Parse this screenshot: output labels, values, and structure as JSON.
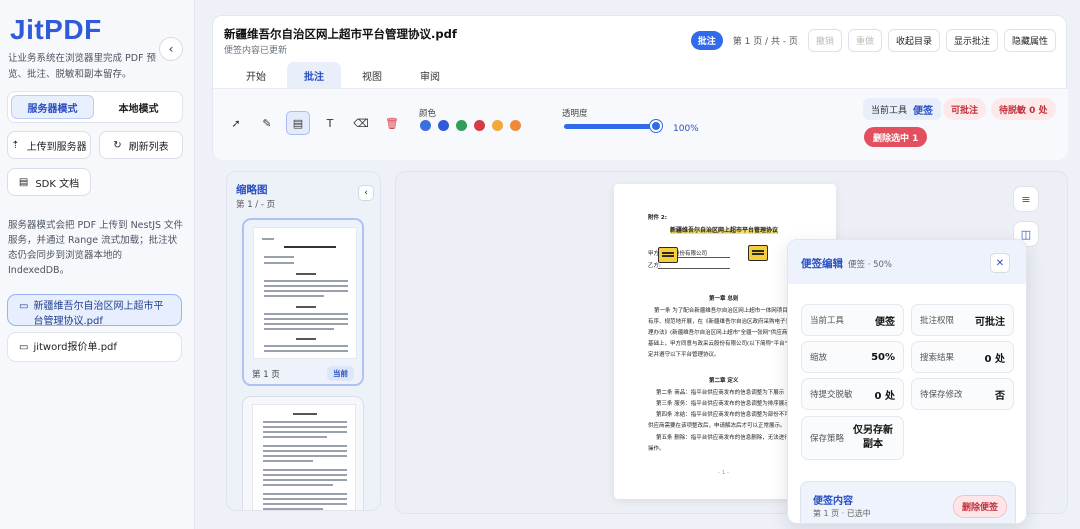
{
  "sidebar": {
    "logo": "JitPDF",
    "intro": "让业务系统在浏览器里完成 PDF 预览、批注、脱敏和副本留存。",
    "modes": [
      "服务器模式",
      "本地模式"
    ],
    "buttons": {
      "upload": "上传到服务器",
      "refresh": "刷新列表",
      "sdk": "SDK 文档"
    },
    "note": "服务器模式会把 PDF 上传到 NestJS 文件服务，并通过 Range 流式加载；批注状态仍会同步到浏览器本地的 IndexedDB。",
    "files": [
      "新疆维吾尔自治区网上超市平台管理协议.pdf",
      "jitword报价单.pdf"
    ]
  },
  "header": {
    "title": "新疆维吾尔自治区网上超市平台管理协议.pdf",
    "subtitle": "便签内容已更新",
    "badge": "批注",
    "page_info": "第 1 页 / 共 - 页",
    "undo": "撤销",
    "redo": "重做",
    "collapse_toc": "收起目录",
    "show_annotations": "显示批注",
    "hide_properties": "隐藏属性"
  },
  "tabs": [
    "开始",
    "批注",
    "视图",
    "审阅"
  ],
  "toolbar": {
    "color_label": "颜色",
    "colors": [
      "#3b6fe0",
      "#2f5bd8",
      "#2f9e58",
      "#d63a48",
      "#f0a93a",
      "#f08a3a"
    ],
    "opacity_label": "透明度",
    "opacity_value": "100%",
    "opacity_fraction": 1.0,
    "current_tool_label": "当前工具",
    "current_tool": "便签",
    "can_annotate": "可批注",
    "pending_redaction": "待脱敏 0 处",
    "delete_selected": "删除选中 1"
  },
  "thumbnails": {
    "title": "缩略图",
    "sub": "第 1 / - 页",
    "page1_label": "第 1 页",
    "current_tag": "当前"
  },
  "document": {
    "attachment": "附件 2:",
    "title": "新疆维吾尔自治区网上超市平台管理协议",
    "party_a": "甲方:",
    "party_a_name": "股份有限公司",
    "party_b": "乙方:",
    "chapter1": "第一章 总则",
    "para1": "第一条 为了配合新疆维吾尔自治区网上超市一体网项目",
    "para1b": "有序、规范地开展，在《新疆维吾尔自治区政府采购电子卖场",
    "para1c": "理办法》(新疆维吾尔自治区网上超市\"全疆一张网\"供应商承诺",
    "para1d": "基础上，甲方同意与政采云股份有限公司(以下简称\"平台\"",
    "para1e": "定并遵守以下平台管理协议。",
    "chapter2": "第二章 定义",
    "def2": "第二条 商品：指平台供应商发布的信息调整为下展示",
    "def3": "第三条 服务：指平台供应商发布的信息调整为排序展示",
    "def4": "第四条 冻结：指平台供应商发布的信息调整为部份不可",
    "def4b": "供应商需要在该项整改后，申请解冻后才可以正常展示。",
    "def5": "第五条 删除：指平台供应商发布的信息删除，无法进行",
    "def5b": "操作。",
    "page_no": "- 1 -"
  },
  "edit_panel": {
    "title": "便签编辑",
    "sub": "便签 · 50%",
    "cells": [
      {
        "label": "当前工具",
        "value": "便签"
      },
      {
        "label": "批注权限",
        "value": "可批注"
      },
      {
        "label": "缩放",
        "value": "50%"
      },
      {
        "label": "搜索结果",
        "value": "0 处"
      },
      {
        "label": "待提交脱敏",
        "value": "0 处"
      },
      {
        "label": "待保存修改",
        "value": "否"
      },
      {
        "label": "保存策略",
        "value": "仅另存新副本"
      }
    ],
    "section_title": "便签内容",
    "section_sub": "第 1 页 · 已选中",
    "delete_note": "删除便签"
  }
}
